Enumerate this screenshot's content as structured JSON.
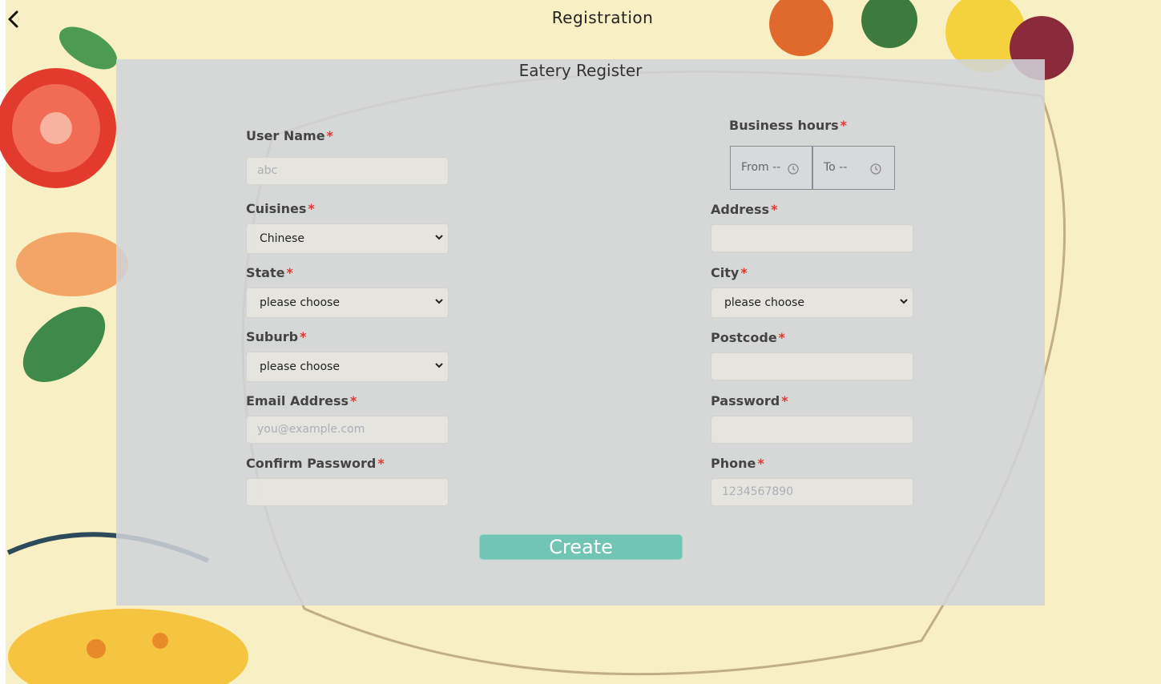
{
  "header": {
    "title": "Registration"
  },
  "form": {
    "title": "Eatery Register",
    "required_mark": "*",
    "user_name": {
      "label": "User Name",
      "placeholder": "abc"
    },
    "cuisines": {
      "label": "Cuisines",
      "value": "Chinese"
    },
    "state": {
      "label": "State",
      "value": "please choose"
    },
    "suburb": {
      "label": "Suburb",
      "value": "please choose"
    },
    "email": {
      "label": "Email Address",
      "placeholder": "you@example.com"
    },
    "confirm_password": {
      "label": "Confirm Password",
      "placeholder": ""
    },
    "business_hours": {
      "label": "Business hours",
      "from": "From --",
      "to": "To --"
    },
    "address": {
      "label": "Address",
      "placeholder": ""
    },
    "city": {
      "label": "City",
      "value": "please choose"
    },
    "postcode": {
      "label": "Postcode",
      "placeholder": ""
    },
    "password": {
      "label": "Password",
      "placeholder": ""
    },
    "phone": {
      "label": "Phone",
      "placeholder": "1234567890"
    },
    "create_button": "Create"
  },
  "icons": {
    "back": "chevron-left-icon",
    "dropdown": "chevron-down-icon",
    "clock": "clock-icon"
  },
  "colors": {
    "background": "#f8f0c4",
    "panel": "#d0d4da",
    "required": "#e3342f",
    "button": "#72c5b4"
  }
}
